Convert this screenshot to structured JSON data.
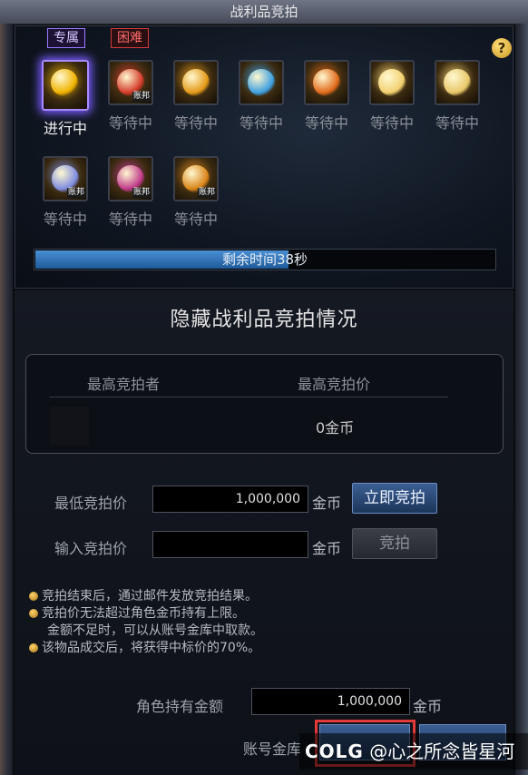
{
  "window": {
    "title": "战利品竞拍"
  },
  "tags": {
    "exclusive": "专属",
    "hard": "困难"
  },
  "help_label": "?",
  "items": [
    {
      "status": "进行中",
      "active": true,
      "color": "#f0b400",
      "badge": ""
    },
    {
      "status": "等待中",
      "active": false,
      "color": "#d43b2a",
      "badge": "账邦"
    },
    {
      "status": "等待中",
      "active": false,
      "color": "#e59a18",
      "badge": ""
    },
    {
      "status": "等待中",
      "active": false,
      "color": "#3fa0e0",
      "badge": ""
    },
    {
      "status": "等待中",
      "active": false,
      "color": "#e06a1a",
      "badge": ""
    },
    {
      "status": "等待中",
      "active": false,
      "color": "#f2d070",
      "badge": ""
    },
    {
      "status": "等待中",
      "active": false,
      "color": "#e8c86a",
      "badge": ""
    },
    {
      "status": "等待中",
      "active": false,
      "color": "#7f8de0",
      "badge": "账邦"
    },
    {
      "status": "等待中",
      "active": false,
      "color": "#c03a8a",
      "badge": "账邦"
    },
    {
      "status": "等待中",
      "active": false,
      "color": "#d9851a",
      "badge": "账邦"
    }
  ],
  "timer": {
    "text": "剩余时间38秒",
    "progress": 0.55
  },
  "section_title": "隐藏战利品竞拍情况",
  "bid_table": {
    "col_bidder": "最高竞拍者",
    "col_price": "最高竞拍价",
    "price_value": "0金币"
  },
  "min_bid": {
    "label": "最低竞拍价",
    "value": "1,000,000",
    "unit": "金币",
    "button": "立即竞拍"
  },
  "input_bid": {
    "label": "输入竞拍价",
    "value": "",
    "unit": "金币",
    "button": "竞拍"
  },
  "notes": [
    "竞拍结束后，通过邮件发放竞拍结果。",
    "竞拍价无法超过角色金币持有上限。",
    "金额不足时，可以从账号金库中取款。",
    "该物品成交后，将获得中标价的70%。"
  ],
  "gold": {
    "label": "角色持有金额",
    "value": "1,000,000",
    "unit": "金币"
  },
  "account_label": "账号金库",
  "bottom_buttons": {
    "left": "",
    "right": ""
  },
  "watermark": {
    "logo": "COLG",
    "text": "@心之所念皆星河"
  }
}
